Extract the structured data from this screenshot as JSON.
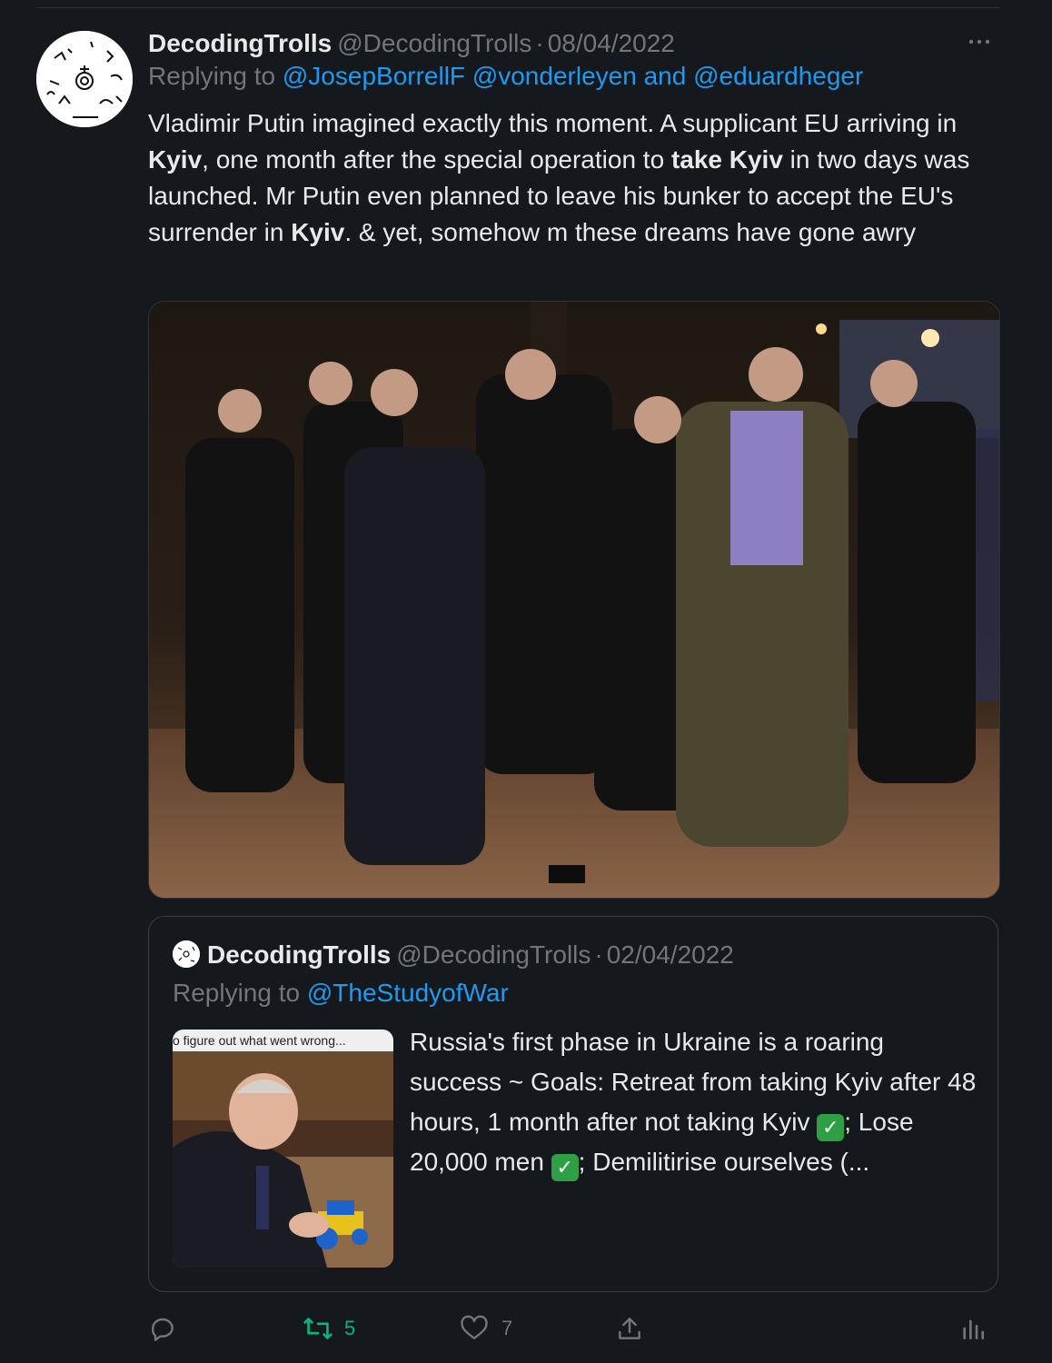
{
  "tweet": {
    "display_name": "DecodingTrolls",
    "handle": "@DecodingTrolls",
    "dot": "·",
    "date": "08/04/2022",
    "replying_label": "Replying to ",
    "replying_users": [
      "@JosepBorrellF",
      "@vonderleyen"
    ],
    "replying_and": " and ",
    "replying_last": "@eduardheger",
    "text_parts": [
      {
        "t": "Vladimir Putin imagined exactly this moment. A supplicant EU arriving in ",
        "b": false
      },
      {
        "t": "Kyiv",
        "b": true
      },
      {
        "t": ", one month after the special operation to ",
        "b": false
      },
      {
        "t": "take Kyiv",
        "b": true
      },
      {
        "t": " in two days was launched. Mr Putin even planned to leave his bunker to accept the EU's surrender in ",
        "b": false
      },
      {
        "t": "Kyiv",
        "b": true
      },
      {
        "t": ". & yet, somehow m these dreams have gone awry",
        "b": false
      }
    ]
  },
  "quote": {
    "display_name": "DecodingTrolls",
    "handle": "@DecodingTrolls",
    "dot": "·",
    "date": "02/04/2022",
    "replying_label": "Replying to ",
    "replying_user": "@TheStudyofWar",
    "thumb_caption": "o figure out what went wrong...",
    "text_1": "Russia's first phase in Ukraine is a roaring success ~ Goals: Retreat from taking Kyiv after 48 hours, 1 month after not taking Kyiv ",
    "text_2": "; Lose 20,000 men ",
    "text_3": "; Demilitirise ourselves (...",
    "check_glyph": "✓"
  },
  "actions": {
    "reply_count": "",
    "retweet_count": "5",
    "like_count": "7",
    "retweet_color": "#00ba7c",
    "muted_color": "#71767b"
  }
}
